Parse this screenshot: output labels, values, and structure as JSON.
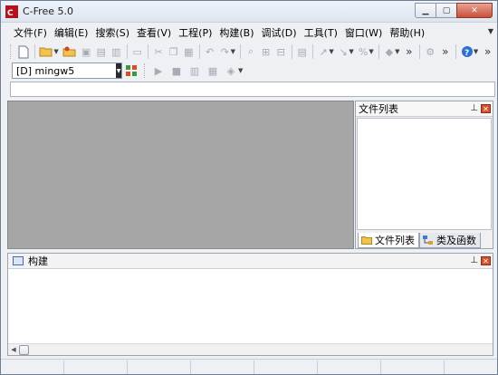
{
  "window": {
    "title": "C-Free 5.0",
    "controls": {
      "minimize": "▁",
      "maximize": "▢",
      "close": "✕"
    }
  },
  "menubar": {
    "items": [
      "文件(F)",
      "编辑(E)",
      "搜索(S)",
      "查看(V)",
      "工程(P)",
      "构建(B)",
      "调试(D)",
      "工具(T)",
      "窗口(W)",
      "帮助(H)"
    ]
  },
  "toolbar": {
    "compiler_value": "[D] mingw5",
    "overflow": "»"
  },
  "file_panel": {
    "title": "文件列表",
    "pin": "꜖",
    "tabs": [
      {
        "label": "文件列表",
        "icon": "folder-icon"
      },
      {
        "label": "类及函数",
        "icon": "class-tree-icon"
      }
    ]
  },
  "build_panel": {
    "title": "构建"
  },
  "colors": {
    "editor_background": "#a6a6a6",
    "close_button": "#c9503a"
  }
}
